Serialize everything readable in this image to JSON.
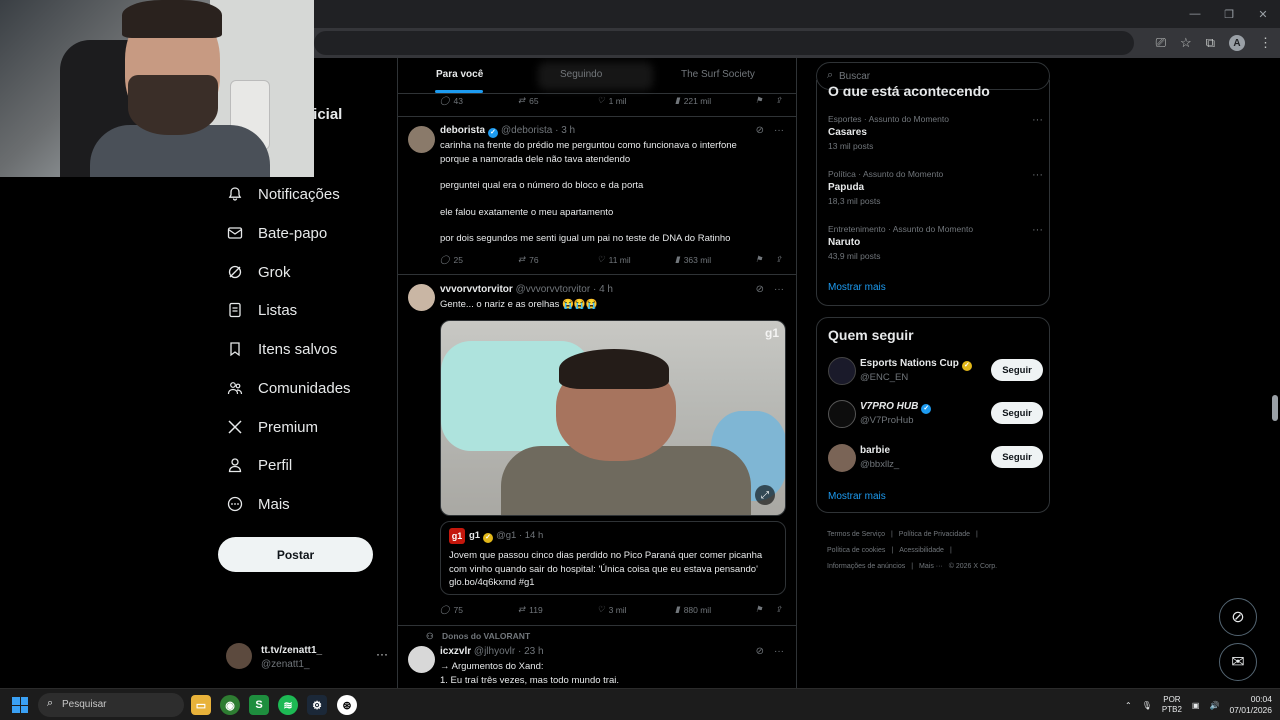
{
  "nav": {
    "home_partial": "nicial",
    "items": [
      {
        "label": "Notificações",
        "icon": "bell-icon"
      },
      {
        "label": "Bate-papo",
        "icon": "mail-icon"
      },
      {
        "label": "Grok",
        "icon": "grok-icon"
      },
      {
        "label": "Listas",
        "icon": "list-icon"
      },
      {
        "label": "Itens salvos",
        "icon": "bookmark-icon"
      },
      {
        "label": "Comunidades",
        "icon": "communities-icon"
      },
      {
        "label": "Premium",
        "icon": "x-logo-icon"
      },
      {
        "label": "Perfil",
        "icon": "person-icon"
      },
      {
        "label": "Mais",
        "icon": "more-circle-icon"
      }
    ],
    "post_label": "Postar",
    "profile_name": "tt.tv/zenatt1_",
    "profile_handle": "@zenatt1_",
    "profile_more": "···"
  },
  "tabs": {
    "for_you": "Para você",
    "following": "Seguindo",
    "community": "The Surf Society"
  },
  "tweets": {
    "top_actions": {
      "replies": "43",
      "retweets": "65",
      "likes": "1 mil",
      "views": "221 mil"
    },
    "t1": {
      "name": "deborista",
      "handle": "@deborista",
      "time": "· 3 h",
      "lines": [
        "carinha na frente do prédio me perguntou como funcionava o interfone",
        "porque a namorada dele não tava atendendo",
        "perguntei qual era o número do bloco e da porta",
        "ele falou exatamente o meu apartamento",
        "por dois segundos me senti igual um pai no teste de DNA do Ratinho"
      ],
      "replies": "25",
      "retweets": "76",
      "likes": "11 mil",
      "views": "363 mil"
    },
    "t2": {
      "name": "vvvorvvtorvitor",
      "handle": "@vvvorvvtorvitor",
      "time": "· 4 h",
      "text": "Gente... o nariz e as orelhas 😭😭😭",
      "media_watermark": "g1",
      "quote_logo": "g1",
      "quote_name": "g1",
      "quote_meta": "@g1 · 14 h",
      "quote_text": "Jovem que passou cinco dias perdido no Pico Paraná quer comer picanha com vinho quando sair do hospital: 'Única coisa que eu estava pensando' glo.bo/4q6kxmd #g1",
      "replies": "75",
      "retweets": "119",
      "likes": "3 mil",
      "views": "880 mil"
    },
    "t3": {
      "community": "Donos do VALORANT",
      "name": "icxzvlr",
      "handle": "@jlhyovlr",
      "time": "· 23 h",
      "line1": "→ Argumentos do Xand:",
      "line2": "1. Eu traí três vezes, mas todo mundo trai."
    }
  },
  "right": {
    "search_placeholder": "Buscar",
    "trends_heading": "O que está acontecendo",
    "trends": [
      {
        "category": "Esportes · Assunto do Momento",
        "name": "Casares",
        "posts": "13 mil posts"
      },
      {
        "category": "Política · Assunto do Momento",
        "name": "Papuda",
        "posts": "18,3 mil posts"
      },
      {
        "category": "Entretenimento · Assunto do Momento",
        "name": "Naruto",
        "posts": "43,9 mil posts"
      }
    ],
    "show_more": "Mostrar mais",
    "follow_heading": "Quem seguir",
    "follow": [
      {
        "name": "Esports Nations Cup",
        "handle": "@ENC_EN",
        "button": "Seguir",
        "badge": "gold"
      },
      {
        "name": "V7PRO HUB",
        "handle": "@V7ProHub",
        "button": "Seguir",
        "badge": "blue"
      },
      {
        "name": "barbie",
        "handle": "@bbxllz_",
        "button": "Seguir",
        "badge": "none"
      }
    ],
    "footer": [
      "Termos de Serviço",
      "|",
      "Política de Privacidade",
      "|",
      "Política de cookies",
      "|",
      "Acessibilidade",
      "|",
      "Informações de anúncios",
      "|",
      "Mais ···",
      "© 2026 X Corp."
    ]
  },
  "taskbar": {
    "search_label": "Pesquisar",
    "lang_1": "POR",
    "lang_2": "PTB2",
    "time": "00:04",
    "date": "07/01/2026"
  },
  "browser": {
    "profile_letter": "A"
  },
  "colors": {
    "accent": "#1d9bf0",
    "bg": "#000000",
    "border": "#2f3336",
    "muted": "#71767b"
  }
}
